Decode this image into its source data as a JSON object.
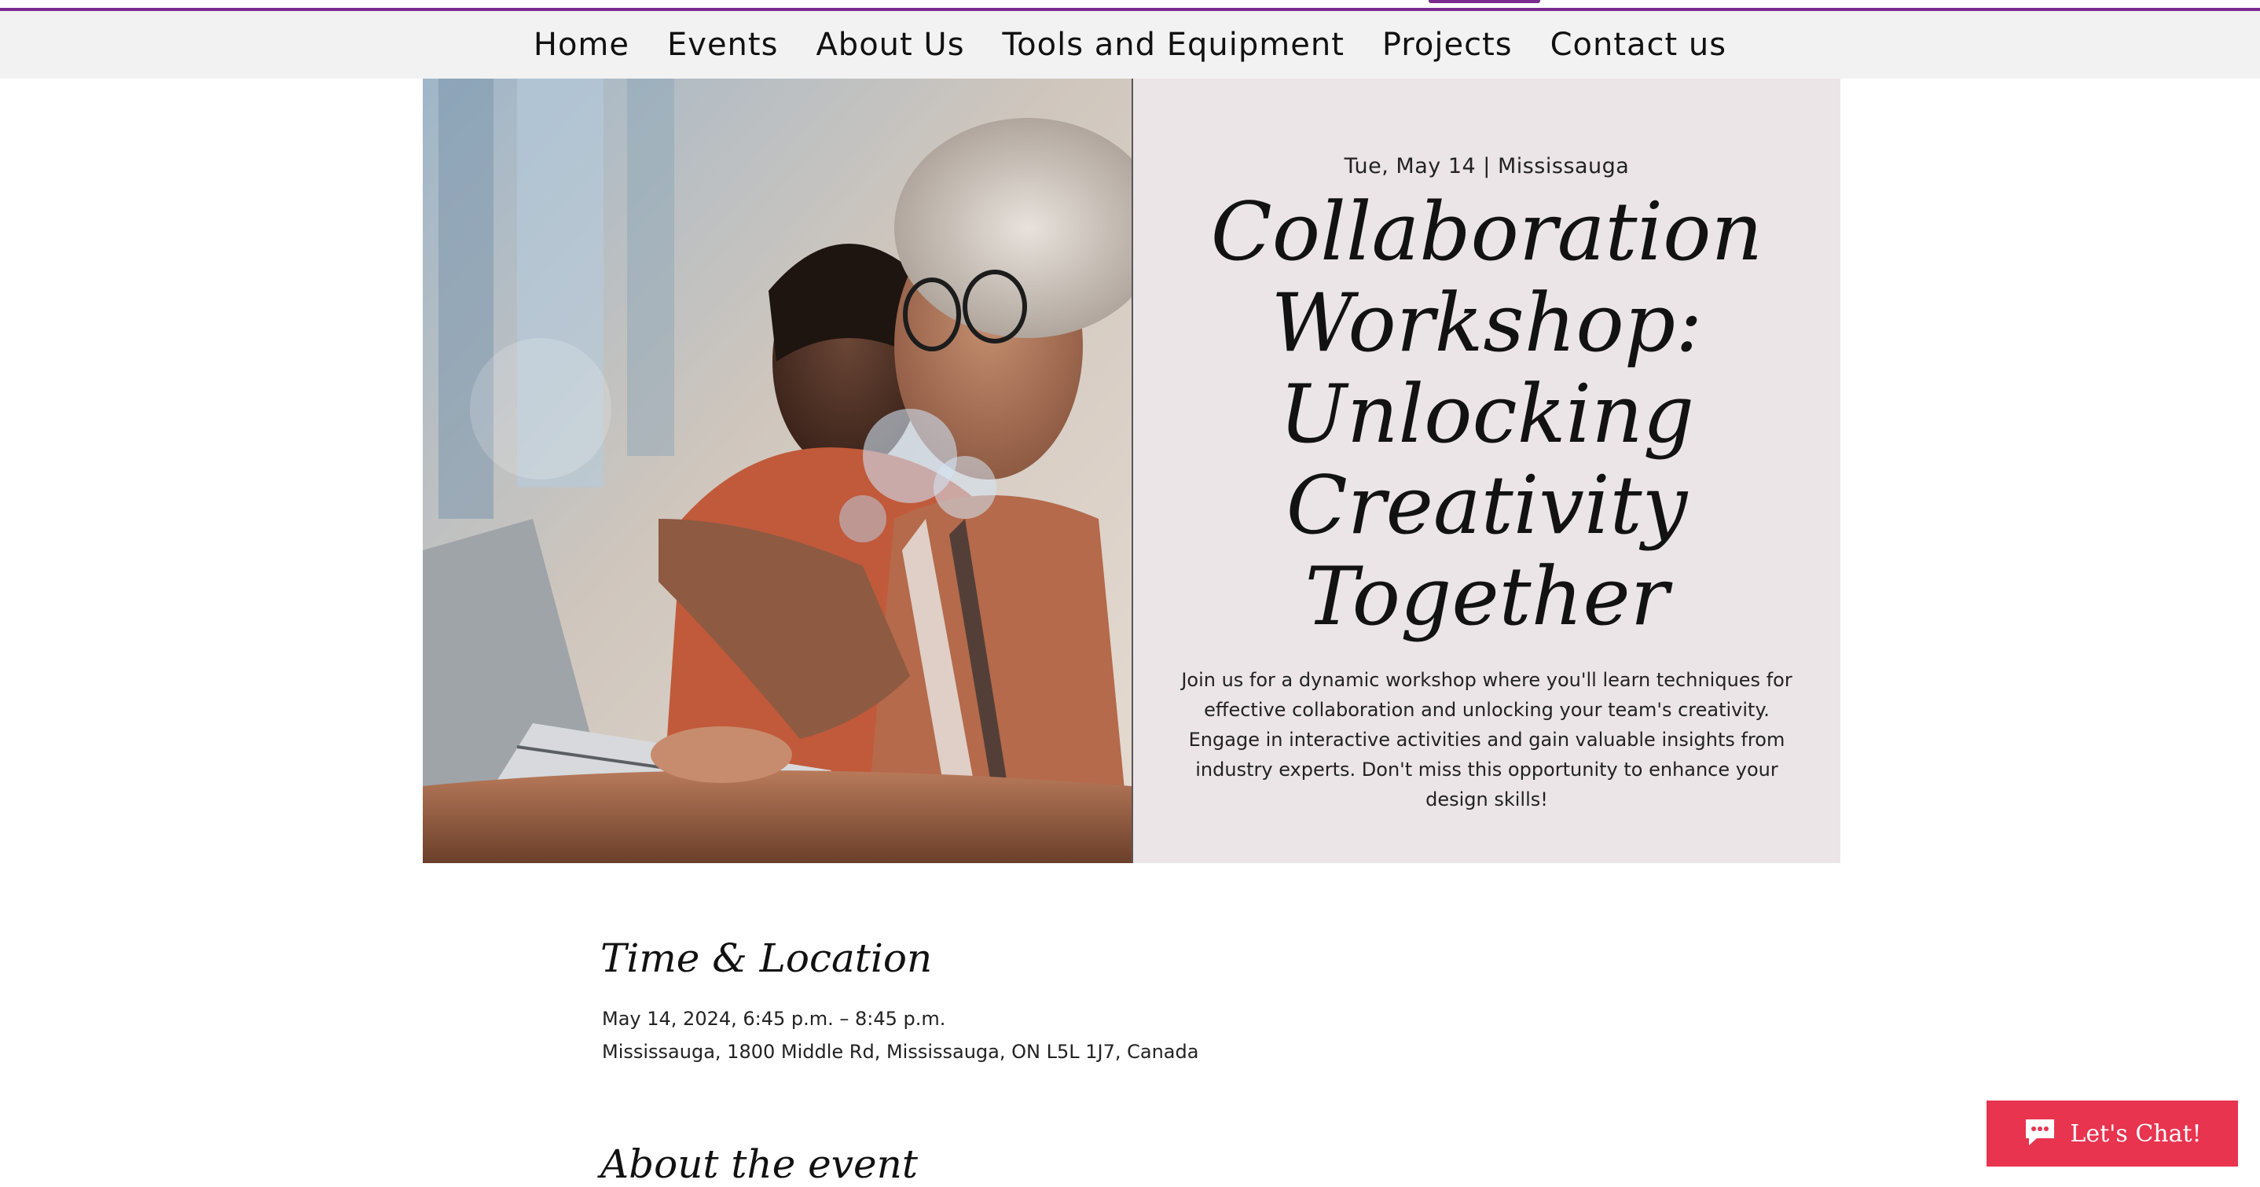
{
  "nav": {
    "items": [
      {
        "label": "Home"
      },
      {
        "label": "Events"
      },
      {
        "label": "About Us"
      },
      {
        "label": "Tools and Equipment"
      },
      {
        "label": "Projects"
      },
      {
        "label": "Contact us"
      }
    ]
  },
  "hero": {
    "photo_icon": "photo-of-two-women-at-laptop",
    "date_location": "Tue, May 14  |  Mississauga",
    "title": "Collaboration Workshop: Unlocking Creativity Together",
    "description": "Join us for a dynamic workshop where you'll learn techniques for effective collaboration and unlocking your team's creativity. Engage in interactive activities and gain valuable insights from industry experts. Don't miss this opportunity to enhance your design skills!"
  },
  "details": {
    "time_heading": "Time & Location",
    "time": "May 14, 2024, 6:45 p.m. – 8:45 p.m.",
    "location": "Mississauga, 1800 Middle Rd, Mississauga, ON L5L 1J7, Canada",
    "about_heading": "About the event"
  },
  "chat": {
    "label": "Let's Chat!",
    "icon": "chat-bubble-icon"
  },
  "colors": {
    "accent": "#7a2b8e",
    "panel": "#ebe5e8",
    "chat": "#e8344f"
  }
}
